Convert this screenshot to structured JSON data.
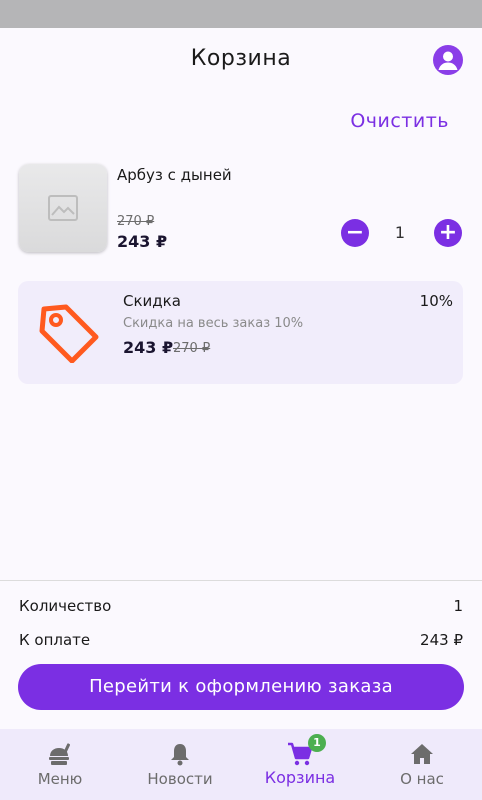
{
  "header": {
    "title": "Корзина",
    "profile_icon": "user-circle-icon"
  },
  "clear_label": "Очистить",
  "cart_item": {
    "name": "Арбуз с дыней",
    "old_price": "270 ₽",
    "price": "243 ₽",
    "quantity": "1",
    "minus_label": "−",
    "plus_label": "+",
    "image_icon": "image-placeholder-icon"
  },
  "discount": {
    "title": "Скидка",
    "percent": "10%",
    "description": "Скидка на весь заказ 10%",
    "price": "243 ₽",
    "old_price": "270 ₽",
    "icon": "price-tag-icon"
  },
  "summary": {
    "quantity_label": "Количество",
    "quantity_value": "1",
    "total_label": "К оплате",
    "total_value": "243 ₽"
  },
  "checkout_label": "Перейти к оформлению заказа",
  "nav": [
    {
      "label": "Меню",
      "icon": "food-icon"
    },
    {
      "label": "Новости",
      "icon": "bell-icon"
    },
    {
      "label": "Корзина",
      "icon": "cart-icon",
      "badge": "1",
      "active": true
    },
    {
      "label": "О нас",
      "icon": "home-icon"
    }
  ],
  "colors": {
    "accent": "#7b2fe3",
    "tag_icon": "#ff5a1f",
    "badge": "#4caf50",
    "nav_background": "#efeafb",
    "card_background": "#f1edfb"
  }
}
